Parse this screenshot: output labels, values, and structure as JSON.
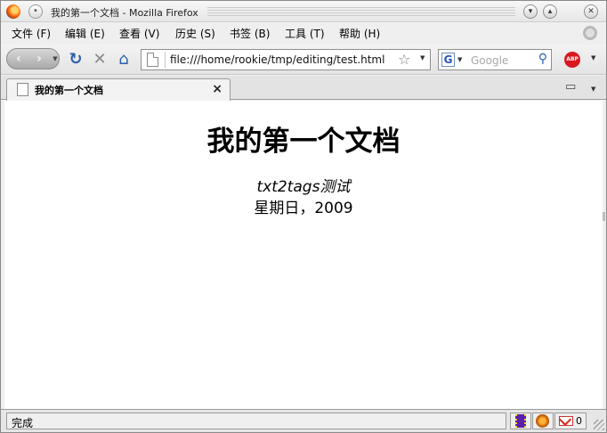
{
  "window": {
    "title": "我的第一个文档 - Mozilla Firefox"
  },
  "menubar": {
    "items": [
      "文件 (F)",
      "编辑 (E)",
      "查看 (V)",
      "历史 (S)",
      "书签 (B)",
      "工具 (T)",
      "帮助 (H)"
    ]
  },
  "navbar": {
    "url": "file:///home/rookie/tmp/editing/test.html",
    "search_engine_letter": "G",
    "search_placeholder": "Google",
    "adblock_label": "ABP"
  },
  "tab": {
    "label": "我的第一个文档"
  },
  "document": {
    "title": "我的第一个文档",
    "subtitle": "txt2tags测试",
    "date": "星期日，2009"
  },
  "statusbar": {
    "text": "完成",
    "gmail_count": "0"
  },
  "colors": {
    "accent_blue": "#2a5db0",
    "adblock_red": "#d9181e"
  }
}
